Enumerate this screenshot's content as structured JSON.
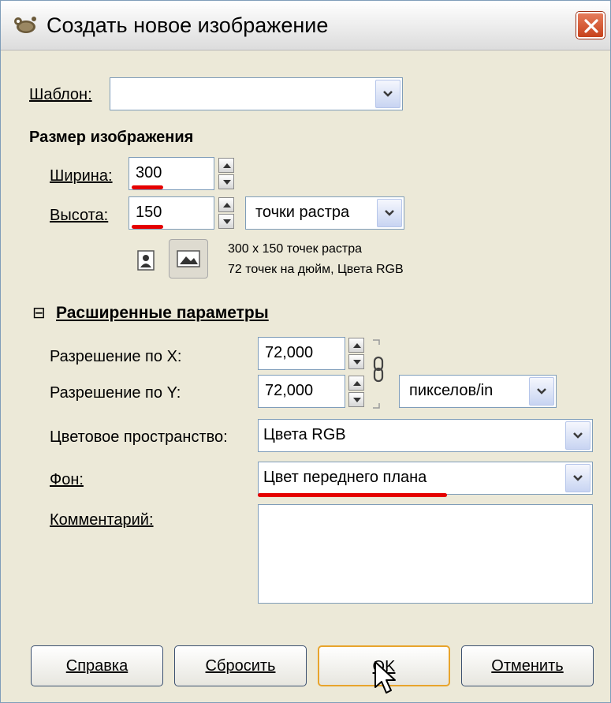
{
  "window": {
    "title": "Создать новое изображение"
  },
  "template": {
    "label": "Шаблон:",
    "value": ""
  },
  "image_size": {
    "heading": "Размер изображения",
    "width_label": "Ширина:",
    "width_value": "300",
    "height_label": "Высота:",
    "height_value": "150",
    "unit": "точки растра",
    "info_line1": "300 x 150 точек растра",
    "info_line2": "72 точек на дюйм, Цвета RGB"
  },
  "advanced": {
    "heading": "Расширенные параметры",
    "toggle_symbol": "⊟",
    "xres_label": "Разрешение по X:",
    "xres_value": "72,000",
    "yres_label": "Разрешение по Y:",
    "yres_value": "72,000",
    "res_unit": "пикселов/in",
    "colorspace_label": "Цветовое пространство:",
    "colorspace_value": "Цвета RGB",
    "fill_label": "Фон:",
    "fill_value": "Цвет переднего плана",
    "comment_label": "Комментарий:",
    "comment_value": ""
  },
  "buttons": {
    "help": "Справка",
    "reset": "Сбросить",
    "ok": "OK",
    "cancel": "Отменить"
  },
  "colors": {
    "annotation": "#e50000",
    "default_button_border": "#e8a42c"
  },
  "icons": [
    "gimp-icon",
    "close-icon",
    "portrait-icon",
    "landscape-icon",
    "chain-link-icon",
    "cursor-icon"
  ]
}
